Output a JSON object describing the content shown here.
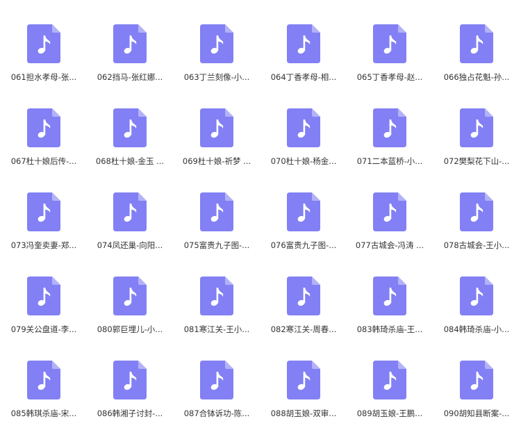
{
  "view": "file-grid",
  "icon": {
    "name": "music-note-file-icon",
    "fill": "#8280f4",
    "fold": "#b3b2f8",
    "glyph": "#ffffff"
  },
  "files": [
    {
      "label": "061担水孝母-张..."
    },
    {
      "label": "062挡马-张红娜..."
    },
    {
      "label": "063丁兰刻像-小..."
    },
    {
      "label": "064丁香孝母-相..."
    },
    {
      "label": "065丁香孝母-赵..."
    },
    {
      "label": "066独占花魁-孙..."
    },
    {
      "label": "067杜十娘后传-..."
    },
    {
      "label": "068杜十娘-金玉 ..."
    },
    {
      "label": "069杜十娘-祈梦 ..."
    },
    {
      "label": "070杜十娘-杨金..."
    },
    {
      "label": "071二本蓝桥-小..."
    },
    {
      "label": "072樊梨花下山-..."
    },
    {
      "label": "073冯奎卖妻-郑..."
    },
    {
      "label": "074凤还巢-向阳..."
    },
    {
      "label": "075富贵九子图-..."
    },
    {
      "label": "076富贵九子图-..."
    },
    {
      "label": "077古城会-冯涛 ..."
    },
    {
      "label": "078古城会-王小..."
    },
    {
      "label": "079关公盘道-李..."
    },
    {
      "label": "080郭巨埋儿-小..."
    },
    {
      "label": "081寒江关-王小..."
    },
    {
      "label": "082寒江关-周春..."
    },
    {
      "label": "083韩琦杀庙-王..."
    },
    {
      "label": "084韩琦杀庙-小..."
    },
    {
      "label": "085韩琪杀庙-宋..."
    },
    {
      "label": "086韩湘子讨封-..."
    },
    {
      "label": "087合钵诉功-陈..."
    },
    {
      "label": "088胡玉娘-双审..."
    },
    {
      "label": "089胡玉娘-王鹏..."
    },
    {
      "label": "090胡知县断案-..."
    }
  ]
}
